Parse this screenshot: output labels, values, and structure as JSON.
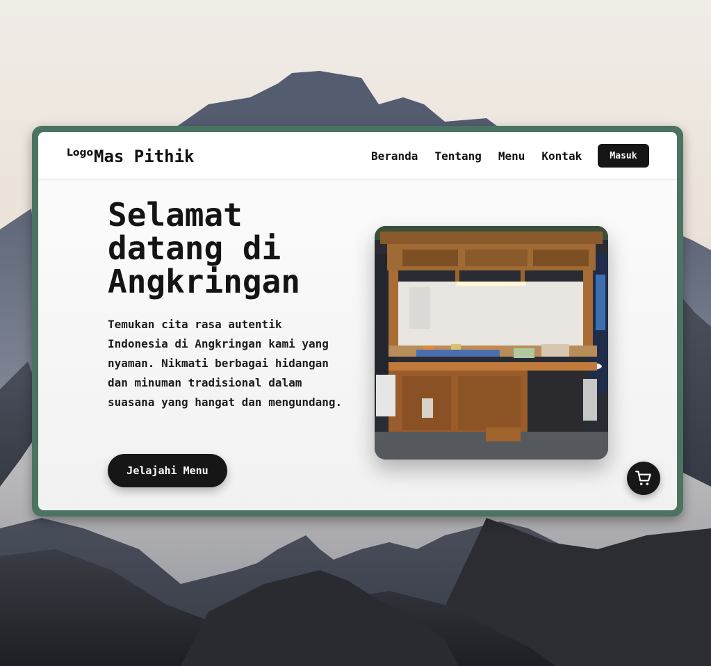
{
  "nav": {
    "logo_text": "Logo",
    "brand": "Mas Pithik",
    "links": [
      {
        "label": "Beranda"
      },
      {
        "label": "Tentang"
      },
      {
        "label": "Menu"
      },
      {
        "label": "Kontak"
      }
    ],
    "login_label": "Masuk"
  },
  "hero": {
    "title": "Selamat datang di Angkringan",
    "description": "Temukan cita rasa autentik Indonesia di Angkringan kami yang nyaman. Nikmati berbagai hidangan dan minuman tradisional dalam suasana yang hangat dan mengundang.",
    "cta_label": "Jelajahi Menu",
    "image_icon": "angkringan-cart-photo"
  },
  "cart": {
    "icon": "shopping-cart-icon"
  },
  "colors": {
    "frame": "#4c7361",
    "button": "#161616",
    "text": "#141414"
  }
}
